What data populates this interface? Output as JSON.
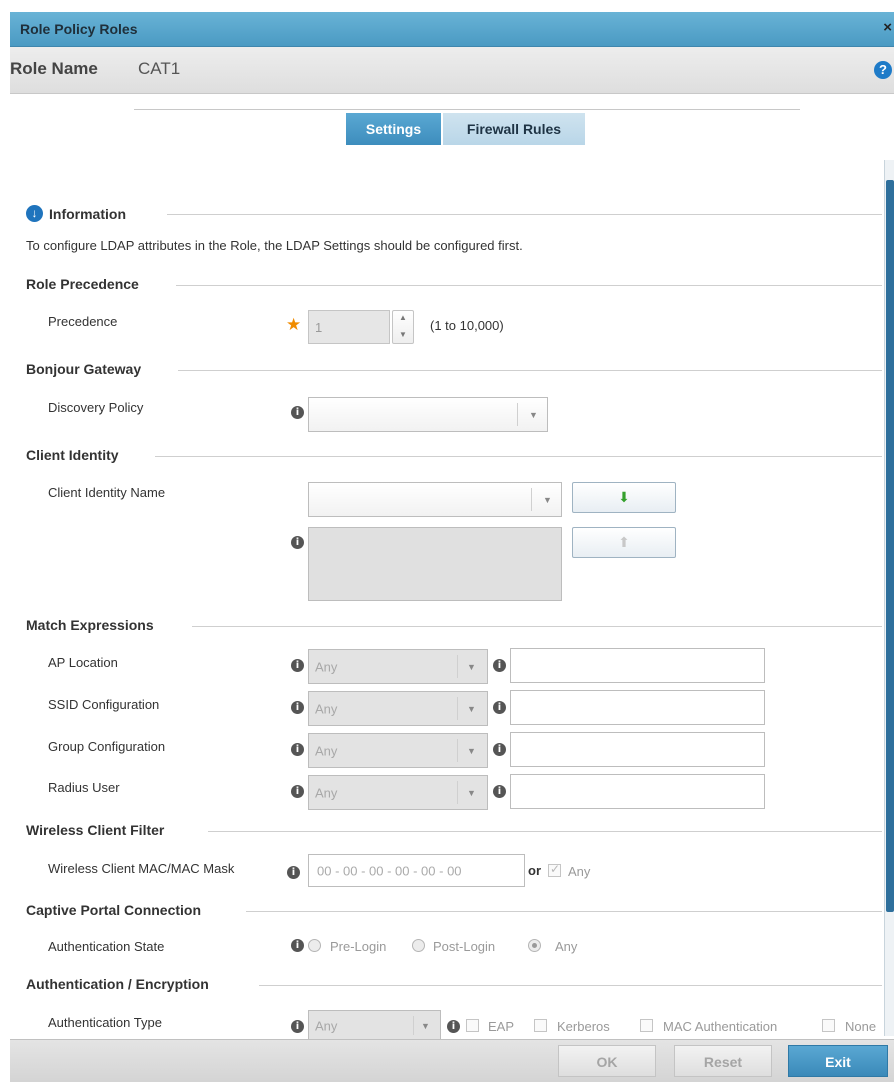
{
  "window": {
    "title": "Role Policy Roles",
    "close_glyph": "×",
    "role_name_label": "Role Name",
    "role_name_value": "CAT1",
    "help_glyph": "?"
  },
  "tabs": [
    {
      "label": "Settings",
      "active": true
    },
    {
      "label": "Firewall Rules",
      "active": false
    }
  ],
  "information": {
    "title": "Information",
    "text": "To configure LDAP attributes in the Role, the LDAP Settings should be configured first."
  },
  "role_precedence": {
    "title": "Role Precedence",
    "precedence_label": "Precedence",
    "precedence_value": "1",
    "precedence_range": "(1 to 10,000)"
  },
  "bonjour_gateway": {
    "title": "Bonjour Gateway",
    "discovery_policy_label": "Discovery Policy",
    "discovery_policy_value": ""
  },
  "client_identity": {
    "title": "Client Identity",
    "name_label": "Client Identity Name",
    "name_value": ""
  },
  "match_expressions": {
    "title": "Match Expressions",
    "rows": [
      {
        "label": "AP Location",
        "operator": "Any",
        "value": ""
      },
      {
        "label": "SSID Configuration",
        "operator": "Any",
        "value": ""
      },
      {
        "label": "Group Configuration",
        "operator": "Any",
        "value": ""
      },
      {
        "label": "Radius User",
        "operator": "Any",
        "value": ""
      }
    ]
  },
  "wireless_client_filter": {
    "title": "Wireless Client Filter",
    "mac_label": "Wireless Client MAC/MAC Mask",
    "mac_placeholder": "00 - 00 - 00 - 00 - 00 - 00",
    "or_text": "or",
    "any_label": "Any",
    "any_checked": true
  },
  "captive_portal": {
    "title": "Captive Portal Connection",
    "auth_state_label": "Authentication State",
    "options": [
      "Pre-Login",
      "Post-Login",
      "Any"
    ],
    "selected": "Any"
  },
  "auth_encryption": {
    "title": "Authentication / Encryption",
    "auth_type_label": "Authentication Type",
    "auth_type_value": "Any",
    "checkboxes": [
      "EAP",
      "Kerberos",
      "MAC Authentication",
      "None"
    ]
  },
  "footer": {
    "ok_label": "OK",
    "reset_label": "Reset",
    "exit_label": "Exit"
  },
  "icons": {
    "info": "i",
    "collapse": "↓",
    "dropdown_arrow": "▼",
    "spinner_up": "▲",
    "spinner_down": "▼",
    "move_down": "⬇",
    "move_up": "⬆",
    "required": "★",
    "checkmark": "✓"
  },
  "colors": {
    "title_bar": "#4a9ac3",
    "tab_active": "#3d8dbd",
    "tab_inactive": "#b9d6e8",
    "required_star": "#f08c00",
    "exit_button": "#3a89b9",
    "scroll_thumb": "#2e6f9c"
  }
}
